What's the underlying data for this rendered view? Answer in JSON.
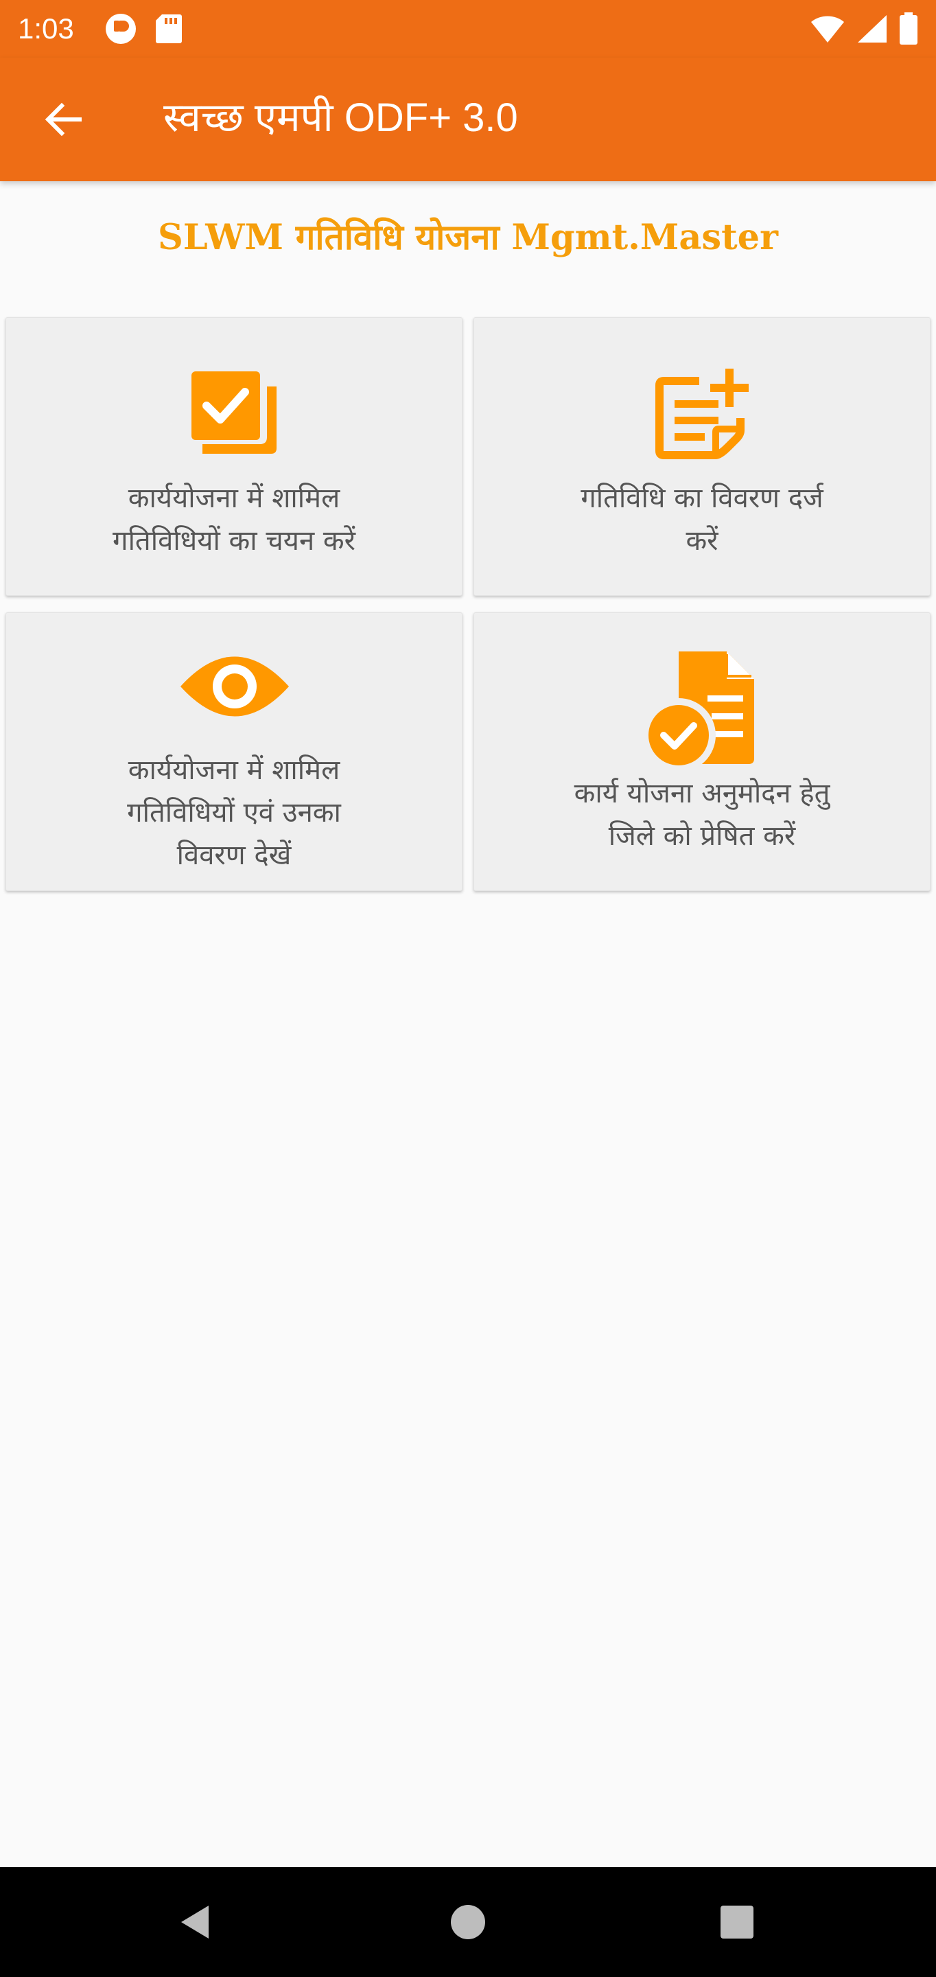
{
  "status_bar": {
    "time": "1:03",
    "left_icons": [
      "notification-app-icon",
      "sd-card-icon"
    ],
    "right_icons": [
      "wifi-icon",
      "signal-icon",
      "battery-icon"
    ]
  },
  "app_bar": {
    "back_icon": "arrow-left-icon",
    "title": "स्वच्छ एमपी ODF+ 3.0"
  },
  "page": {
    "heading": "SLWM गतिविधि योजना Mgmt.Master"
  },
  "cards": [
    {
      "icon": "checklist-icon",
      "label": "कार्ययोजना में शामिल\nगतिविधियों का चयन करें"
    },
    {
      "icon": "add-note-icon",
      "label": "गतिविधि का विवरण दर्ज\nकरें"
    },
    {
      "icon": "eye-icon",
      "label": "कार्ययोजना में शामिल\nगतिविधियों एवं उनका\nविवरण देखें"
    },
    {
      "icon": "document-approved-icon",
      "label": "कार्य योजना अनुमोदन हेतु\nजिले को प्रेषित करें"
    }
  ],
  "nav_bar": {
    "buttons": [
      "back-triangle-icon",
      "home-circle-icon",
      "recents-square-icon"
    ]
  },
  "colors": {
    "primary": "#ee6d15",
    "accent": "#f59e0b",
    "icon": "#ff9800",
    "card_background": "#efefef",
    "page_background": "#fafafa",
    "label_text": "#555555"
  }
}
